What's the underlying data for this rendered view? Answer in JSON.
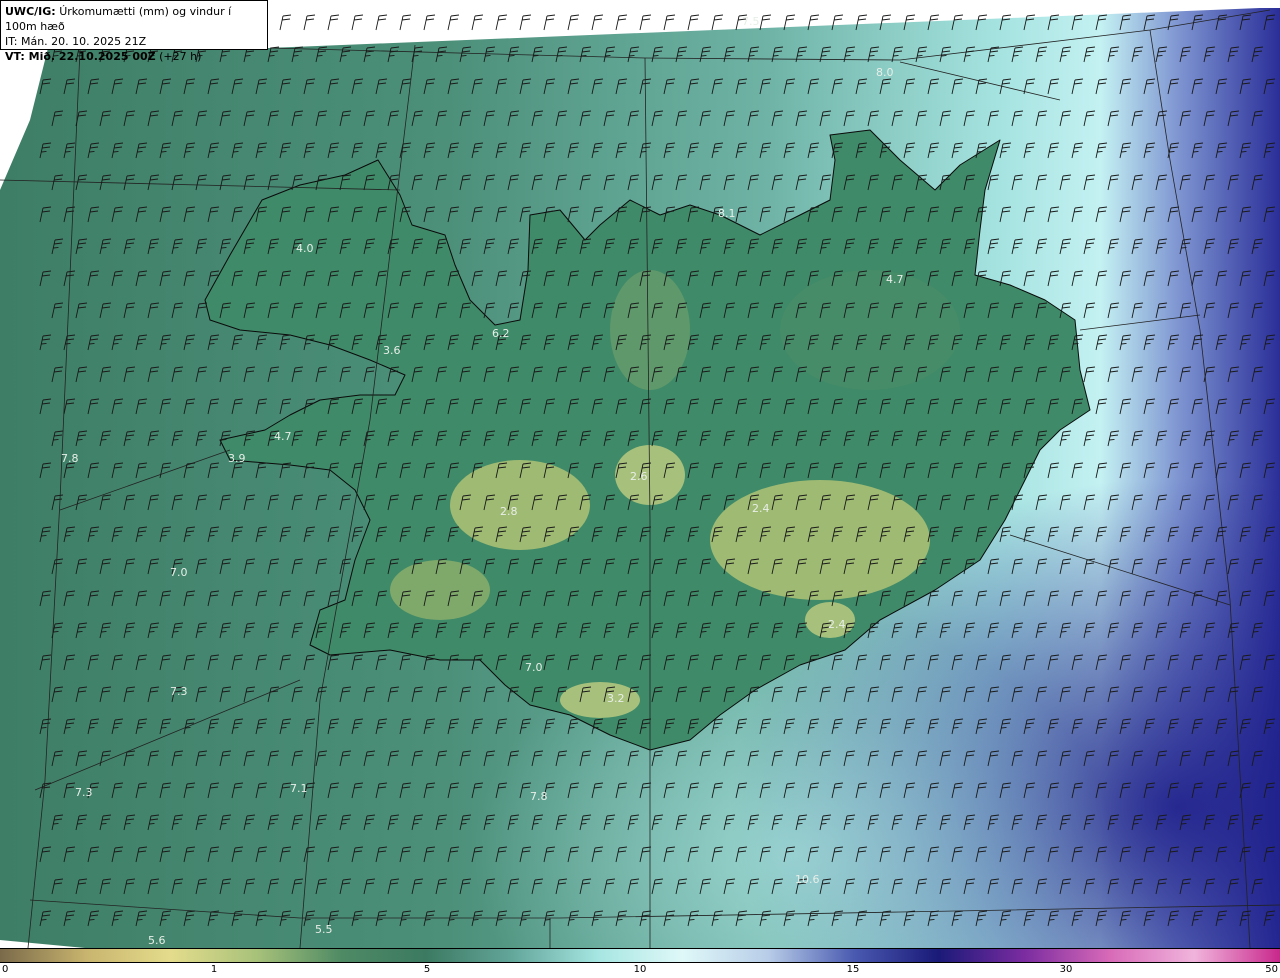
{
  "header": {
    "model_label": "UWC/IG:",
    "title": "Úrkomumætti (mm) og vindur í 100m hæð",
    "it_text": "IT: Mán. 20. 10. 2025 21Z",
    "vt_label": "VT: Mið. 22.10.2025 00Z",
    "vt_offset": "(+27 h)"
  },
  "colorbar": {
    "ticks": [
      "0",
      "1",
      "5",
      "10",
      "15",
      "30",
      "50"
    ],
    "colors": [
      "#7a6a4a",
      "#c8b46e",
      "#e4dc8c",
      "#a8c27a",
      "#4e8a64",
      "#3c7a62",
      "#63a69a",
      "#a6e6e2",
      "#dff8f8",
      "#b8cde8",
      "#4a5ab0",
      "#1a1a78",
      "#7a2ca0",
      "#d86ab8",
      "#f0b4dc",
      "#c8288c"
    ]
  },
  "map": {
    "labels": [
      {
        "text": "7.5"
      },
      {
        "text": "8.0"
      },
      {
        "text": "4.0"
      },
      {
        "text": "4.7"
      },
      {
        "text": "8.1"
      },
      {
        "text": "6.2"
      },
      {
        "text": "3.6"
      },
      {
        "text": "7.8"
      },
      {
        "text": "3.9"
      },
      {
        "text": "4.7"
      },
      {
        "text": "2.6"
      },
      {
        "text": "2.8"
      },
      {
        "text": "2.4"
      },
      {
        "text": "7.0"
      },
      {
        "text": "2.4"
      },
      {
        "text": "7.0"
      },
      {
        "text": "7.3"
      },
      {
        "text": "3.2"
      },
      {
        "text": "7.3"
      },
      {
        "text": "7.1"
      },
      {
        "text": "7.8"
      },
      {
        "text": "10.6"
      },
      {
        "text": "5.6"
      },
      {
        "text": "5.5"
      }
    ]
  }
}
